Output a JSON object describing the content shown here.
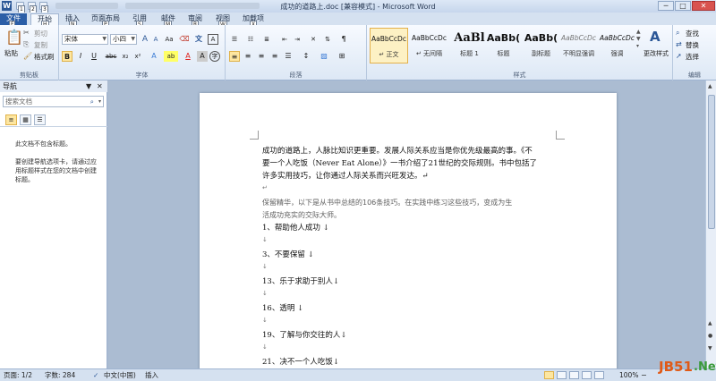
{
  "window": {
    "title": "成功的道路上.doc [兼容模式] - Microsoft Word",
    "logo": "W",
    "minimize": "─",
    "maximize": "□",
    "close": "✕"
  },
  "keytips": {
    "qat": [
      "1",
      "2",
      "3"
    ],
    "tabs": [
      "F",
      "H",
      "N",
      "P",
      "S",
      "M",
      "R",
      "W",
      "X"
    ]
  },
  "tabs": [
    "文件",
    "开始",
    "插入",
    "页面布局",
    "引用",
    "邮件",
    "审阅",
    "视图",
    "加载项"
  ],
  "ribbon": {
    "clipboard": {
      "label": "剪贴板",
      "paste": "粘贴",
      "cut": "剪切",
      "copy": "复制",
      "format_painter": "格式刷"
    },
    "font": {
      "label": "字体",
      "font_name": "宋体",
      "font_size": "小四",
      "bold": "B",
      "italic": "I",
      "underline": "U",
      "strike": "abc",
      "subscript": "x₂",
      "superscript": "x²",
      "grow": "A",
      "shrink": "A",
      "case": "Aa",
      "highlight": "ab",
      "color": "A"
    },
    "paragraph": {
      "label": "段落"
    },
    "styles": {
      "label": "样式",
      "items": [
        {
          "sample": "AaBbCcDc",
          "name": "↵ 正文"
        },
        {
          "sample": "AaBbCcDc",
          "name": "↵ 无间隔"
        },
        {
          "sample": "AaBl",
          "name": "标题 1"
        },
        {
          "sample": "AaBb(",
          "name": "标题"
        },
        {
          "sample": "AaBb(",
          "name": "副标题"
        },
        {
          "sample": "AaBbCcDc",
          "name": "不明显强调"
        },
        {
          "sample": "AaBbCcDc",
          "name": "强调"
        }
      ],
      "change_styles": "更改样式"
    },
    "editing": {
      "label": "编辑",
      "find": "查找",
      "replace": "替换",
      "select": "选择"
    }
  },
  "nav": {
    "title": "导航",
    "search_placeholder": "搜索文档",
    "msg1": "此文档不包含标题。",
    "msg2": "要创建导航选项卡，请通过应用标题样式在您的文档中创建标题。"
  },
  "document": {
    "lines": [
      "成功的道路上，人脉比知识更重要。发展人际关系应当是你优先级最高的事。《不",
      "要一个人吃饭（Never Eat Alone）》一书介绍了21世纪的交际规则。书中包括了",
      "许多实用技巧，让你通过人际关系而兴旺发达。↵",
      "↵",
      "保留精华，以下是从书中总结的106条技巧。在实践中练习这些技巧，变成为生",
      "活成功充实的交际大师。",
      "1、帮助他人成功 ↓",
      "↓",
      "3、不要保留 ↓",
      "↓",
      "13、乐于求助于别人↓",
      "↓",
      "16、透明 ↓",
      "↓",
      "19、了解与你交往的人↓",
      "↓",
      "21、决不一个人吃饭↓"
    ]
  },
  "status": {
    "page": "页面: 1/2",
    "words": "字数: 284",
    "lang": "中文(中国)",
    "mode": "插入",
    "zoom": "100%",
    "watermark_a": "JB51",
    "watermark_b": ".Net"
  },
  "colors": {
    "file_tab": "#2b5ea7",
    "ribbon": "#dde8f5",
    "doc_bg": "#abbcd2",
    "highlight": "#fde6a0"
  }
}
